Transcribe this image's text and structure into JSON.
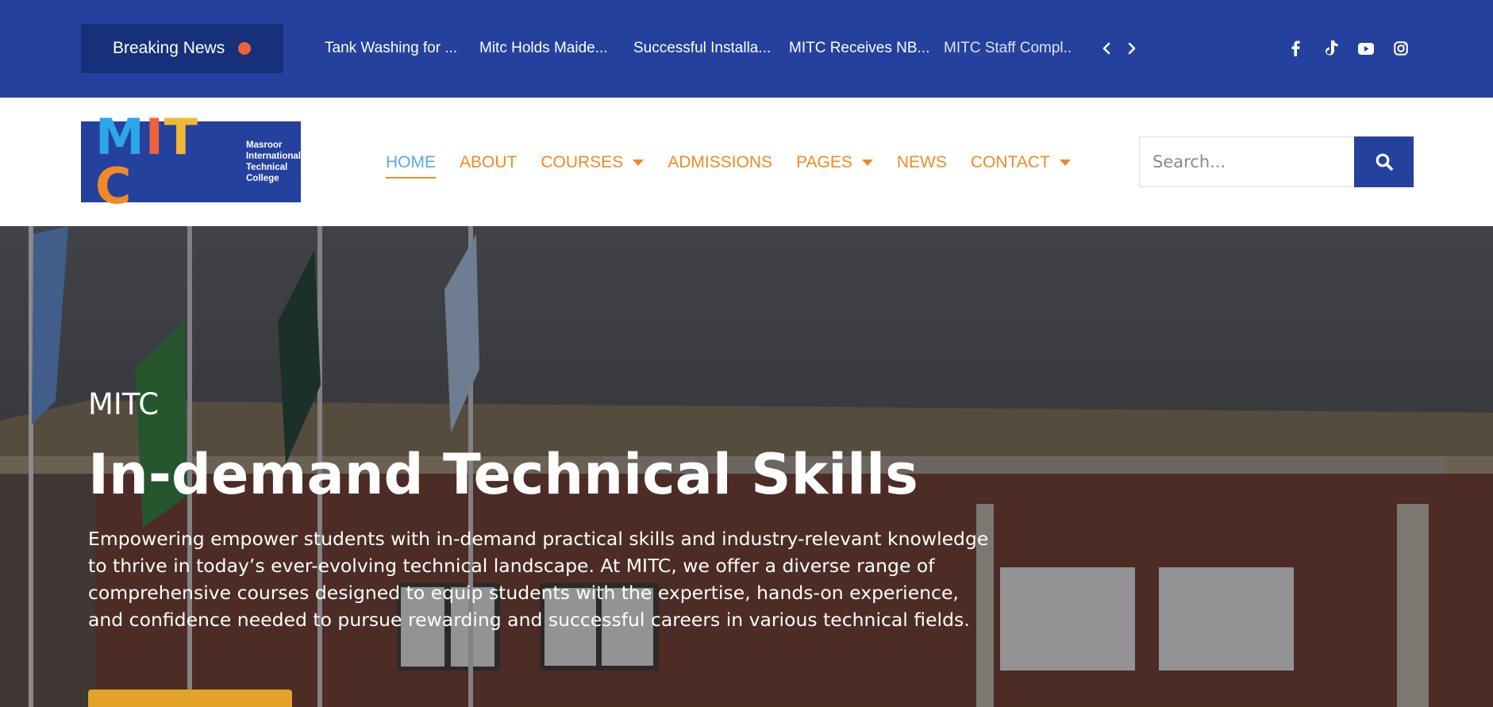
{
  "topbar": {
    "breaking_label": "Breaking News",
    "ticker": [
      "Tank Washing for ...",
      "Mitc Holds Maide...",
      "Successful Installa...",
      "MITC Receives NB...",
      "MITC Staff Compl..."
    ],
    "prev_icon": "chevron-left-icon",
    "next_icon": "chevron-right-icon",
    "socials": [
      "facebook-icon",
      "tiktok-icon",
      "youtube-icon",
      "instagram-icon"
    ],
    "colors": {
      "bar": "#25419e",
      "badge": "#17307a",
      "dot": "#f0623a"
    }
  },
  "header": {
    "logo": {
      "letters": [
        "M",
        "I",
        "T",
        "C"
      ],
      "subtitle_lines": [
        "Masroor",
        "International",
        "Technical",
        "College"
      ]
    },
    "nav": [
      {
        "label": "HOME",
        "active": true,
        "dropdown": false
      },
      {
        "label": "ABOUT",
        "active": false,
        "dropdown": false
      },
      {
        "label": "COURSES",
        "active": false,
        "dropdown": true
      },
      {
        "label": "ADMISSIONS",
        "active": false,
        "dropdown": false
      },
      {
        "label": "PAGES",
        "active": false,
        "dropdown": true
      },
      {
        "label": "NEWS",
        "active": false,
        "dropdown": false
      },
      {
        "label": "CONTACT",
        "active": false,
        "dropdown": true
      }
    ],
    "search": {
      "placeholder": "Search...",
      "value": ""
    },
    "colors": {
      "nav": "#f08a24",
      "active": "#5aa9ea"
    }
  },
  "hero": {
    "kicker": "MITC",
    "title": "In-demand Technical Skills",
    "description": "Empowering empower students with in-demand practical skills and industry-relevant knowledge to thrive in today’s ever-evolving technical landscape. At MITC, we offer a diverse range of comprehensive courses designed to equip students with the expertise, hands-on experience, and confidence needed to pursue rewarding and successful careers in various technical fields.",
    "cta_color": "#e2a32a"
  }
}
